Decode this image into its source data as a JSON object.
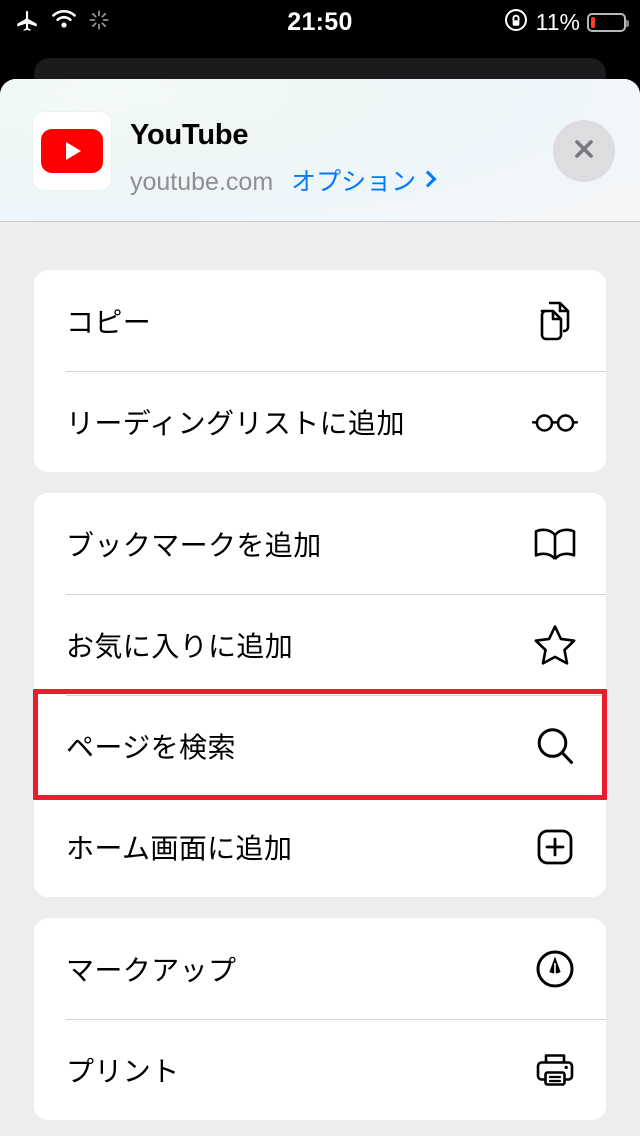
{
  "status_bar": {
    "icons": [
      "airplane-mode-icon",
      "wifi-icon",
      "activity-spinner-icon"
    ],
    "time": "21:50",
    "rotation_lock_icon": "rotation-lock-icon",
    "battery_percent": "11%",
    "battery_level": 11,
    "battery_color": "#ff3b30"
  },
  "share_sheet": {
    "app_name": "YouTube",
    "host": "youtube.com",
    "options_label": "オプション",
    "options_chevron": "chevron-right-icon",
    "close_label": "×",
    "accent_color": "#007aff",
    "groups": [
      {
        "rows": [
          {
            "label": "コピー",
            "icon": "doc-on-doc-icon"
          },
          {
            "label": "リーディングリストに追加",
            "icon": "eyeglasses-icon"
          }
        ]
      },
      {
        "rows": [
          {
            "label": "ブックマークを追加",
            "icon": "book-icon"
          },
          {
            "label": "お気に入りに追加",
            "icon": "star-icon"
          },
          {
            "label": "ページを検索",
            "icon": "magnifier-icon",
            "highlighted": true
          },
          {
            "label": "ホーム画面に追加",
            "icon": "plus-square-icon"
          }
        ]
      },
      {
        "rows": [
          {
            "label": "マークアップ",
            "icon": "markup-pen-icon"
          },
          {
            "label": "プリント",
            "icon": "printer-icon"
          }
        ]
      }
    ]
  },
  "annotation": {
    "target_label": "ページを検索",
    "color": "#ee1b2e"
  }
}
